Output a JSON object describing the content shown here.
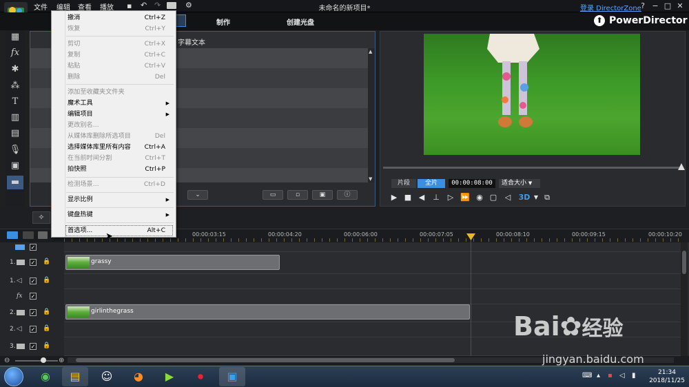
{
  "titlebar": {
    "menus": [
      "文件",
      "编辑",
      "查看",
      "播放"
    ],
    "title": "未命名的新项目*",
    "login": "登录 DirectorZone",
    "help": "?",
    "minimize": "−",
    "restore": "□",
    "close": "✕"
  },
  "header": {
    "tabs": [
      "制作",
      "创建光盘"
    ],
    "brand": "PowerDirector"
  },
  "library": {
    "tab_subtitle": "字幕文本"
  },
  "preview": {
    "modes": [
      "片段",
      "全片"
    ],
    "timecode": "00:00:08:00",
    "fit": "适合大小",
    "threed": "3D"
  },
  "timeline": {
    "ticks": [
      "00:00:03:15",
      "00:00:04:20",
      "00:00:06:00",
      "00:00:07:05",
      "00:00:08:10",
      "00:00:09:15",
      "00:00:10:20"
    ],
    "tracks": [
      {
        "label": "",
        "kind": "header"
      },
      {
        "label": "1.",
        "kind": "video"
      },
      {
        "label": "1.",
        "kind": "audio"
      },
      {
        "label": "fx",
        "kind": "fx"
      },
      {
        "label": "2.",
        "kind": "video"
      },
      {
        "label": "2.",
        "kind": "audio"
      },
      {
        "label": "3.",
        "kind": "video"
      }
    ],
    "clips": [
      {
        "name": "grassy",
        "track": 1
      },
      {
        "name": "girlinthegrass",
        "track": 4
      }
    ]
  },
  "menu": {
    "items": [
      {
        "label": "撤消",
        "key": "Ctrl+Z",
        "enabled": true
      },
      {
        "label": "恢复",
        "key": "Ctrl+Y",
        "enabled": false
      },
      {
        "label": "剪切",
        "key": "Ctrl+X",
        "enabled": false
      },
      {
        "label": "复制",
        "key": "Ctrl+C",
        "enabled": false
      },
      {
        "label": "粘贴",
        "key": "Ctrl+V",
        "enabled": false
      },
      {
        "label": "删除",
        "key": "Del",
        "enabled": false
      },
      {
        "label": "添加至收藏夹文件夹",
        "key": "",
        "enabled": false
      },
      {
        "label": "魔术工具",
        "key": "",
        "enabled": true,
        "submenu": true
      },
      {
        "label": "编辑项目",
        "key": "",
        "enabled": true,
        "submenu": true
      },
      {
        "label": "更改别名...",
        "key": "",
        "enabled": false
      },
      {
        "label": "从媒体库删除所选项目",
        "key": "Del",
        "enabled": false
      },
      {
        "label": "选择媒体库里所有内容",
        "key": "Ctrl+A",
        "enabled": true
      },
      {
        "label": "在当前时间分割",
        "key": "Ctrl+T",
        "enabled": false
      },
      {
        "label": "拍快照",
        "key": "Ctrl+P",
        "enabled": true
      },
      {
        "label": "检测场景...",
        "key": "Ctrl+D",
        "enabled": false
      },
      {
        "label": "显示比例",
        "key": "",
        "enabled": true,
        "submenu": true
      },
      {
        "label": "键盘热键",
        "key": "",
        "enabled": true,
        "submenu": true
      },
      {
        "label": "首选项...",
        "key": "Alt+C",
        "enabled": true
      }
    ]
  },
  "taskbar": {
    "time": "21:34",
    "date": "2018/11/25"
  },
  "watermark": {
    "brand": "Bai",
    "brand2": "经验",
    "url": "jingyan.baidu.com"
  },
  "colors": {
    "accent": "#3a8fe0",
    "playhead": "#c41e1e",
    "clip": "#6d6e72"
  }
}
